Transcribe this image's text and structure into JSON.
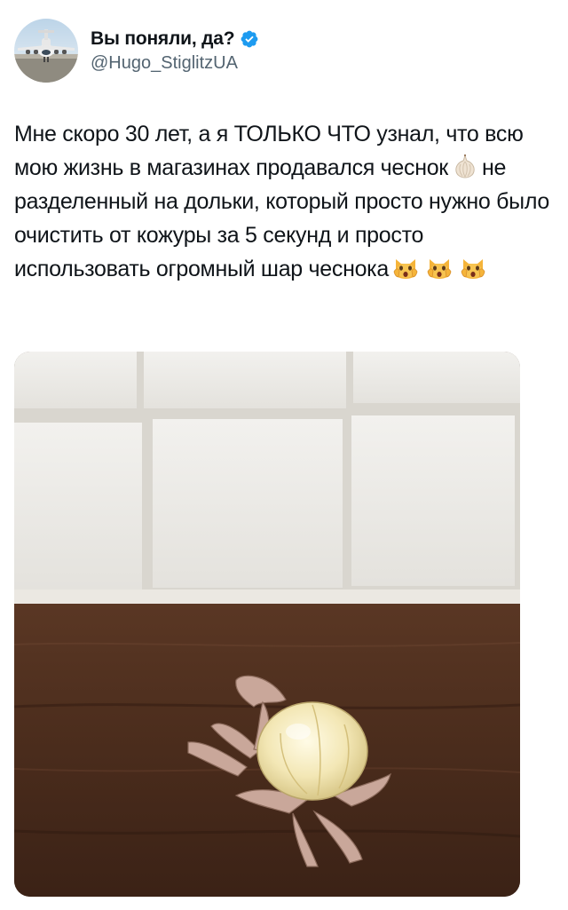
{
  "author": {
    "display_name": "Вы поняли, да?",
    "handle": "@Hugo_StiglitzUA",
    "verified": true,
    "avatar_icon": "airplane-avatar-icon"
  },
  "tweet": {
    "text_parts": [
      "Мне скоро 30 лет, а я ТОЛЬКО ЧТО узнал, что всю мою жизнь в магазинах продавался чеснок",
      "не разделенный на дольки, который просто нужно было очистить от кожуры за 5 секунд и просто использовать огромный шар чеснока"
    ],
    "emojis": [
      "garlic-emoji",
      "weary-cat-emoji",
      "weary-cat-emoji",
      "weary-cat-emoji"
    ]
  },
  "media": {
    "type": "photo",
    "icon": "garlic-bulb-photo"
  },
  "colors": {
    "verified_blue": "#1d9bf0",
    "handle_gray": "#536471",
    "text": "#0f1419"
  }
}
